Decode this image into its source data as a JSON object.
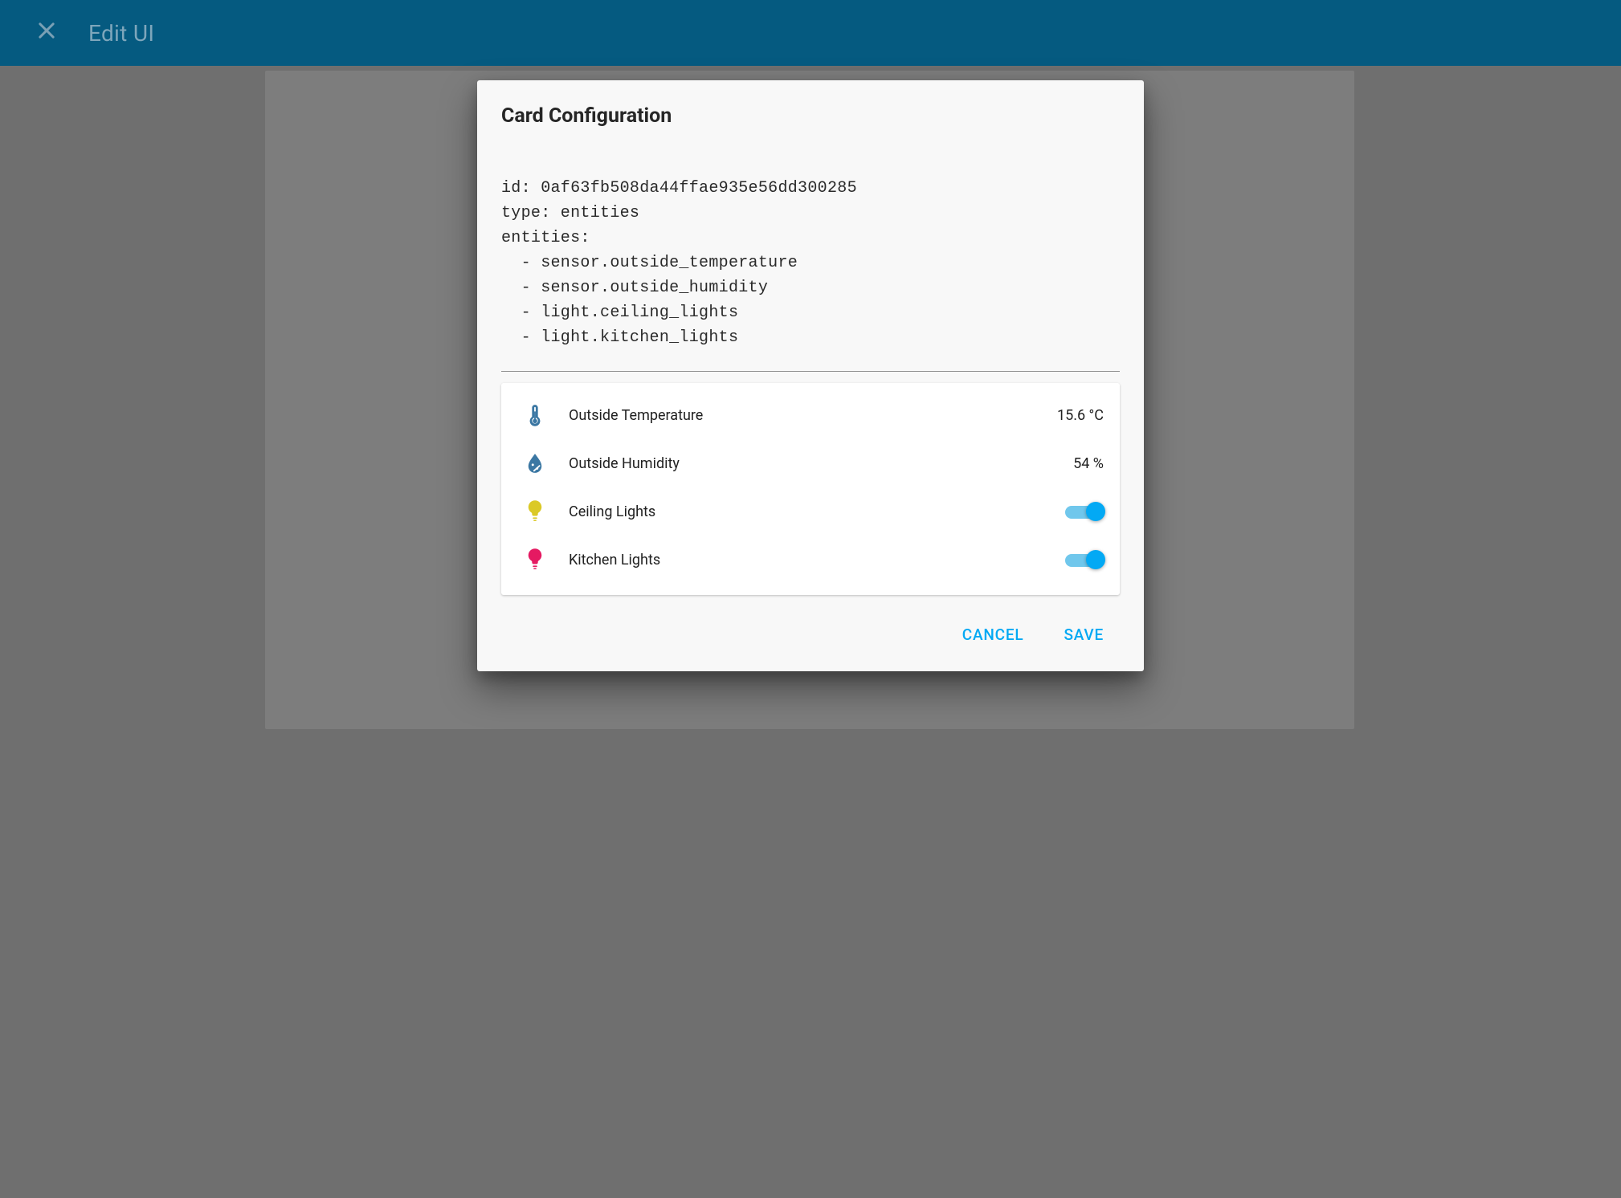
{
  "appbar": {
    "close_label": "Close",
    "title": "Edit UI"
  },
  "dialog": {
    "title": "Card Configuration",
    "yaml": "id: 0af63fb508da44ffae935e56dd300285\ntype: entities\nentities:\n  - sensor.outside_temperature\n  - sensor.outside_humidity\n  - light.ceiling_lights\n  - light.kitchen_lights",
    "actions": {
      "cancel": "CANCEL",
      "save": "SAVE"
    }
  },
  "colors": {
    "accent": "#03a9f4",
    "appbar_bg": "#055a80",
    "icon_blue": "#3b77a3",
    "icon_yellow": "#dbc927",
    "icon_pink": "#e51a62"
  },
  "entities": [
    {
      "icon": "thermometer-icon",
      "icon_color": "blue",
      "name": "Outside Temperature",
      "value": "15.6 °C",
      "control": "value",
      "state": null
    },
    {
      "icon": "humidity-icon",
      "icon_color": "blue",
      "name": "Outside Humidity",
      "value": "54 %",
      "control": "value",
      "state": null
    },
    {
      "icon": "lightbulb-icon",
      "icon_color": "yellow",
      "name": "Ceiling Lights",
      "value": null,
      "control": "toggle",
      "state": true
    },
    {
      "icon": "lightbulb-icon",
      "icon_color": "pink",
      "name": "Kitchen Lights",
      "value": null,
      "control": "toggle",
      "state": true
    }
  ]
}
